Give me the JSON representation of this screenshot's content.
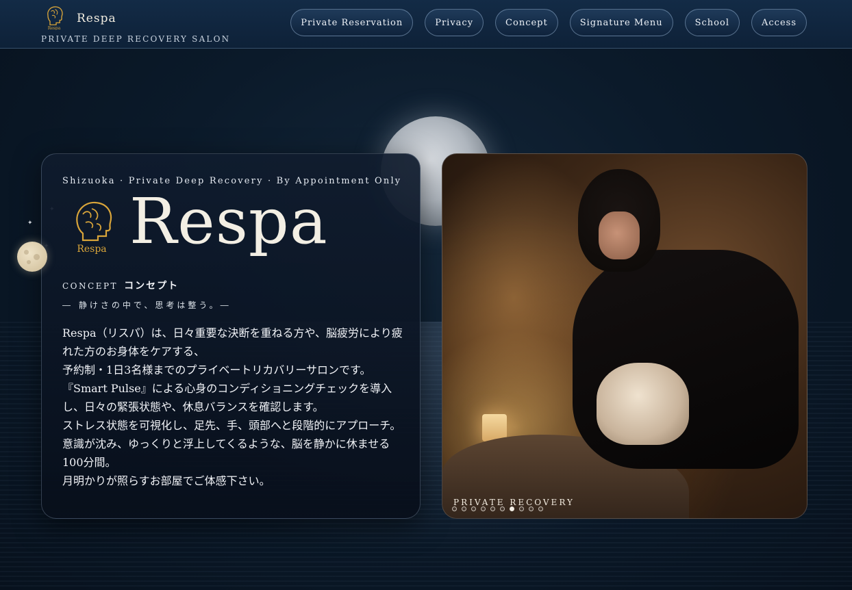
{
  "header": {
    "brand_name": "Respa",
    "brand_tagline": "PRIVATE DEEP RECOVERY SALON",
    "nav": [
      {
        "label": "Private Reservation"
      },
      {
        "label": "Privacy"
      },
      {
        "label": "Concept"
      },
      {
        "label": "Signature Menu"
      },
      {
        "label": "School"
      },
      {
        "label": "Access"
      }
    ]
  },
  "hero": {
    "eyebrow": "Shizuoka · Private Deep Recovery · By Appointment Only",
    "logo_text": "Respa",
    "title": "Respa",
    "concept_en": "CONCEPT",
    "concept_jp": "コンセプト",
    "tagline": "― 静けさの中で、思考は整う。―",
    "paragraphs": [
      "Respa（リスパ）は、日々重要な決断を重ねる方や、脳疲労により疲れた方のお身体をケアする、",
      "予約制・1日3名様までのプライベートリカバリーサロンです。",
      "『Smart Pulse』による心身のコンディショニングチェックを導入し、日々の緊張状態や、休息バランスを確認します。",
      "ストレス状態を可視化し、足先、手、頭部へと段階的にアプローチ。意識が沈み、ゆっくりと浮上してくるような、脳を静かに休ませる100分間。",
      "月明かりが照らすお部屋でご体感下さい。"
    ]
  },
  "photo": {
    "caption": "PRIVATE RECOVERY",
    "slide_count": 10,
    "active_slide": 7
  },
  "colors": {
    "accent_gold": "#d9a53a",
    "background": "#0b1a2a"
  }
}
